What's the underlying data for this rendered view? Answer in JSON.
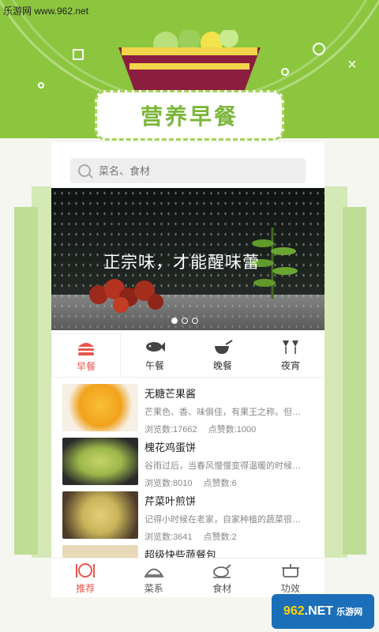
{
  "source_site": "乐游网 www.962.net",
  "title": "营养早餐",
  "search": {
    "placeholder": "菜名、食材"
  },
  "banner": {
    "caption": "正宗味，才能醒味蕾",
    "dots": [
      true,
      false,
      false
    ]
  },
  "meal_tabs": [
    {
      "label": "早餐",
      "icon": "burger-icon",
      "active": true
    },
    {
      "label": "午餐",
      "icon": "fish-icon",
      "active": false
    },
    {
      "label": "晚餐",
      "icon": "pot-icon",
      "active": false
    },
    {
      "label": "夜宵",
      "icon": "wine-glasses-icon",
      "active": false
    }
  ],
  "recipes": [
    {
      "name": "无糖芒果酱",
      "desc": "芒果色、香、味俱佳，有果王之称。但…",
      "views_label": "浏览数:17662",
      "likes_label": "点赞数:1000",
      "thumb_color": "#f2a21b"
    },
    {
      "name": "槐花鸡蛋饼",
      "desc": "谷雨过后，当春风慢慢变得温暖的时候…",
      "views_label": "浏览数:8010",
      "likes_label": "点赞数:6",
      "thumb_color": "#9bb74a"
    },
    {
      "name": "芹菜叶煎饼",
      "desc": "记得小时候在老家，自家种植的蔬菜很…",
      "views_label": "浏览数:3641",
      "likes_label": "点赞数:2",
      "thumb_color": "#c9b45a"
    },
    {
      "name": "超级快些蔬餐包",
      "desc": "",
      "views_label": "",
      "likes_label": "",
      "thumb_color": "#e9d9b8"
    }
  ],
  "tabbar": [
    {
      "label": "推荐",
      "icon": "plate-cutlery-icon",
      "active": true
    },
    {
      "label": "菜系",
      "icon": "cloche-icon",
      "active": false
    },
    {
      "label": "食材",
      "icon": "chicken-icon",
      "active": false
    },
    {
      "label": "功效",
      "icon": "cooking-pot-icon",
      "active": false
    }
  ],
  "watermark": {
    "prefix": "962",
    "suffix": ".NET",
    "sub": "乐游网"
  },
  "colors": {
    "brand_green": "#8cc63f",
    "title_green": "#7cb63a",
    "accent_red": "#e8564d"
  }
}
